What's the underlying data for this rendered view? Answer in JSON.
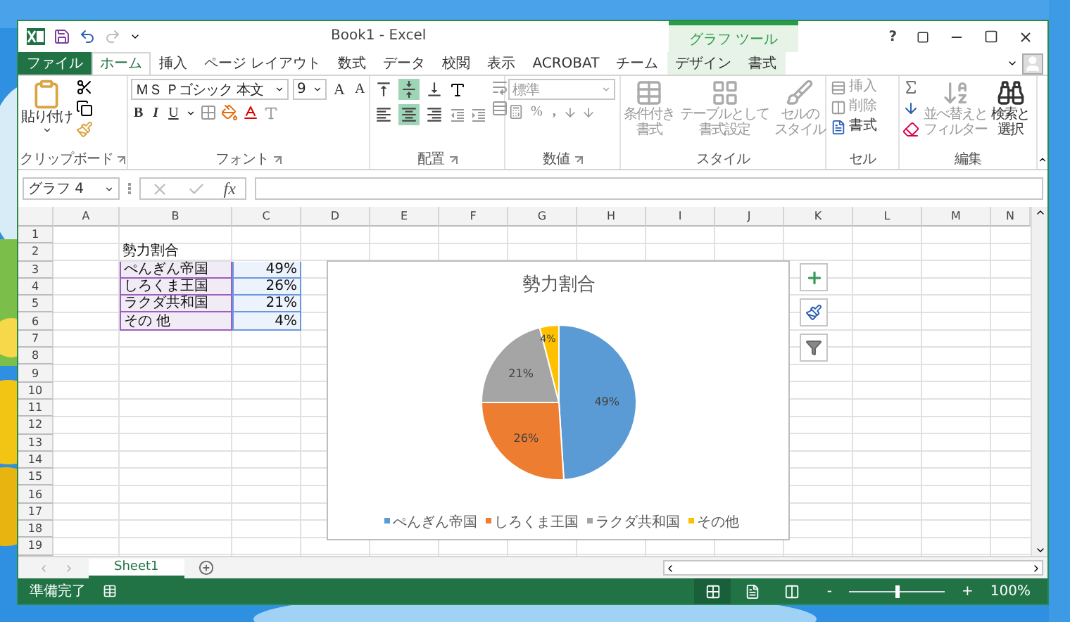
{
  "window": {
    "title": "Book1 - Excel",
    "help": "?"
  },
  "contextual_group": "グラフ ツール",
  "tabs": [
    {
      "label": "ファイル",
      "kind": "file",
      "selected": false
    },
    {
      "label": "ホーム",
      "kind": "normal",
      "selected": true
    },
    {
      "label": "挿入",
      "kind": "normal",
      "selected": false
    },
    {
      "label": "ページ レイアウト",
      "kind": "normal",
      "selected": false
    },
    {
      "label": "数式",
      "kind": "normal",
      "selected": false
    },
    {
      "label": "データ",
      "kind": "normal",
      "selected": false
    },
    {
      "label": "校閲",
      "kind": "normal",
      "selected": false
    },
    {
      "label": "表示",
      "kind": "normal",
      "selected": false
    },
    {
      "label": "ACROBAT",
      "kind": "normal",
      "selected": false
    },
    {
      "label": "チーム",
      "kind": "normal",
      "selected": false
    },
    {
      "label": "デザイン",
      "kind": "contextual",
      "selected": false
    },
    {
      "label": "書式",
      "kind": "contextual",
      "selected": false
    }
  ],
  "ribbon": {
    "clipboard": {
      "label": "クリップボード",
      "paste": "貼り付け"
    },
    "font": {
      "label": "フォント",
      "font_name": "ＭＳ Ｐゴシック 本文",
      "font_size": "9",
      "grow": "A",
      "shrink": "A",
      "bold": "B",
      "italic": "I",
      "underline": "U"
    },
    "alignment": {
      "label": "配置",
      "vertical": [
        {
          "kind": "top",
          "selected": false
        },
        {
          "kind": "middle",
          "selected": true
        },
        {
          "kind": "bottom",
          "selected": false
        }
      ],
      "horizontal": [
        {
          "kind": "left",
          "selected": false
        },
        {
          "kind": "center",
          "selected": true
        },
        {
          "kind": "right",
          "selected": false
        }
      ]
    },
    "number": {
      "label": "数値",
      "format": "標準",
      "percent": "%",
      "comma": ","
    },
    "styles": {
      "label": "スタイル",
      "buttons": [
        {
          "lines": [
            "条件付き",
            "書式"
          ],
          "kind": "conditional",
          "disabled": true
        },
        {
          "lines": [
            "テーブルとして",
            "書式設定"
          ],
          "kind": "table",
          "disabled": true
        },
        {
          "lines": [
            "セルの",
            "スタイル"
          ],
          "kind": "cell",
          "disabled": true
        }
      ]
    },
    "cells": {
      "label": "セル",
      "buttons": [
        {
          "label": "挿入",
          "kind": "insert",
          "disabled": true
        },
        {
          "label": "削除",
          "kind": "delete",
          "disabled": true
        },
        {
          "label": "書式",
          "kind": "format",
          "disabled": false
        }
      ]
    },
    "editing": {
      "label": "編集",
      "buttons": [
        {
          "lines": [
            "並べ替えと",
            "フィルター"
          ],
          "kind": "sort",
          "disabled": true
        },
        {
          "lines": [
            "検索と",
            "選択"
          ],
          "kind": "find",
          "disabled": false
        }
      ]
    }
  },
  "name_box": "グラフ 4",
  "function_label": "fx",
  "sheet": {
    "columns": [
      "A",
      "B",
      "C",
      "D",
      "E",
      "F",
      "G",
      "H",
      "I",
      "J",
      "K",
      "L",
      "M",
      "N"
    ],
    "row_numbers": [
      "1",
      "2",
      "3",
      "4",
      "5",
      "6",
      "7",
      "8",
      "9",
      "10",
      "11",
      "12",
      "13",
      "14",
      "15",
      "16",
      "17",
      "18",
      "19"
    ],
    "data": [
      {
        "cells": [
          {
            "text": "勢力割合",
            "highlighted": false
          }
        ]
      },
      {
        "cells": [
          {
            "text": "ぺんぎん帝国",
            "highlighted": true
          },
          {
            "text": "49%",
            "highlighted": true
          }
        ]
      },
      {
        "cells": [
          {
            "text": "しろくま王国",
            "highlighted": true
          },
          {
            "text": "26%",
            "highlighted": true
          }
        ]
      },
      {
        "cells": [
          {
            "text": "ラクダ共和国",
            "highlighted": true
          },
          {
            "text": "21%",
            "highlighted": true
          }
        ]
      },
      {
        "cells": [
          {
            "text": "その 他",
            "highlighted": true
          },
          {
            "text": "4%",
            "highlighted": true
          }
        ]
      }
    ]
  },
  "chart": {
    "chart_data": {
      "type": "pie",
      "title": "勢力割合",
      "categories": [
        "ぺんぎん帝国",
        "しろくま王国",
        "ラクダ共和国",
        "その他"
      ],
      "series": [
        {
          "values": [
            49,
            26,
            21,
            4
          ]
        }
      ],
      "legend": "bottom",
      "colors": [
        "#5b9bd5",
        "#ed7d31",
        "#a5a5a5",
        "#ffc000"
      ],
      "value_labels": [
        "49%",
        "26%",
        "21%",
        "4%"
      ]
    }
  },
  "sheet_tabs": [
    {
      "label": "Sheet1",
      "selected": true
    }
  ],
  "status_bar": {
    "text": "準備完了",
    "views": [
      {
        "kind": "normal",
        "selected": true
      },
      {
        "kind": "layout",
        "selected": false
      },
      {
        "kind": "break",
        "selected": false
      }
    ],
    "zoom_minus": "-",
    "zoom_plus": "+",
    "zoom": {
      "level": 0.5
    },
    "zoom_text": "100%"
  }
}
